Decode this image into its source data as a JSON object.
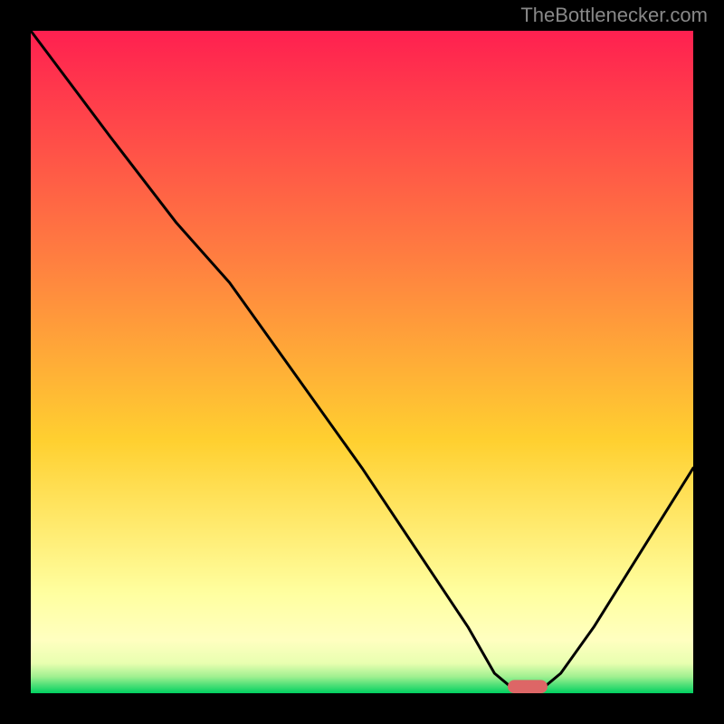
{
  "watermark": "TheBottlenecker.com",
  "chart_data": {
    "type": "line",
    "title": "",
    "xlabel": "",
    "ylabel": "",
    "xlim": [
      0,
      100
    ],
    "ylim": [
      0,
      100
    ],
    "gradient_colors": {
      "top": "#ff2050",
      "mid1": "#ff8040",
      "mid2": "#ffd030",
      "mid3": "#ffff80",
      "bottom": "#00d060"
    },
    "curve": [
      {
        "x": 0,
        "y": 100
      },
      {
        "x": 12,
        "y": 84
      },
      {
        "x": 22,
        "y": 71
      },
      {
        "x": 30,
        "y": 62
      },
      {
        "x": 40,
        "y": 48
      },
      {
        "x": 50,
        "y": 34
      },
      {
        "x": 58,
        "y": 22
      },
      {
        "x": 66,
        "y": 10
      },
      {
        "x": 70,
        "y": 3
      },
      {
        "x": 73,
        "y": 0.5
      },
      {
        "x": 77,
        "y": 0.5
      },
      {
        "x": 80,
        "y": 3
      },
      {
        "x": 85,
        "y": 10
      },
      {
        "x": 90,
        "y": 18
      },
      {
        "x": 95,
        "y": 26
      },
      {
        "x": 100,
        "y": 34
      }
    ],
    "marker": {
      "x": 75,
      "y": 1,
      "color": "#d66",
      "width": 6,
      "height": 2
    },
    "frame_color": "#000000",
    "frame_width": 4,
    "curve_color": "#000000",
    "curve_width": 3
  }
}
